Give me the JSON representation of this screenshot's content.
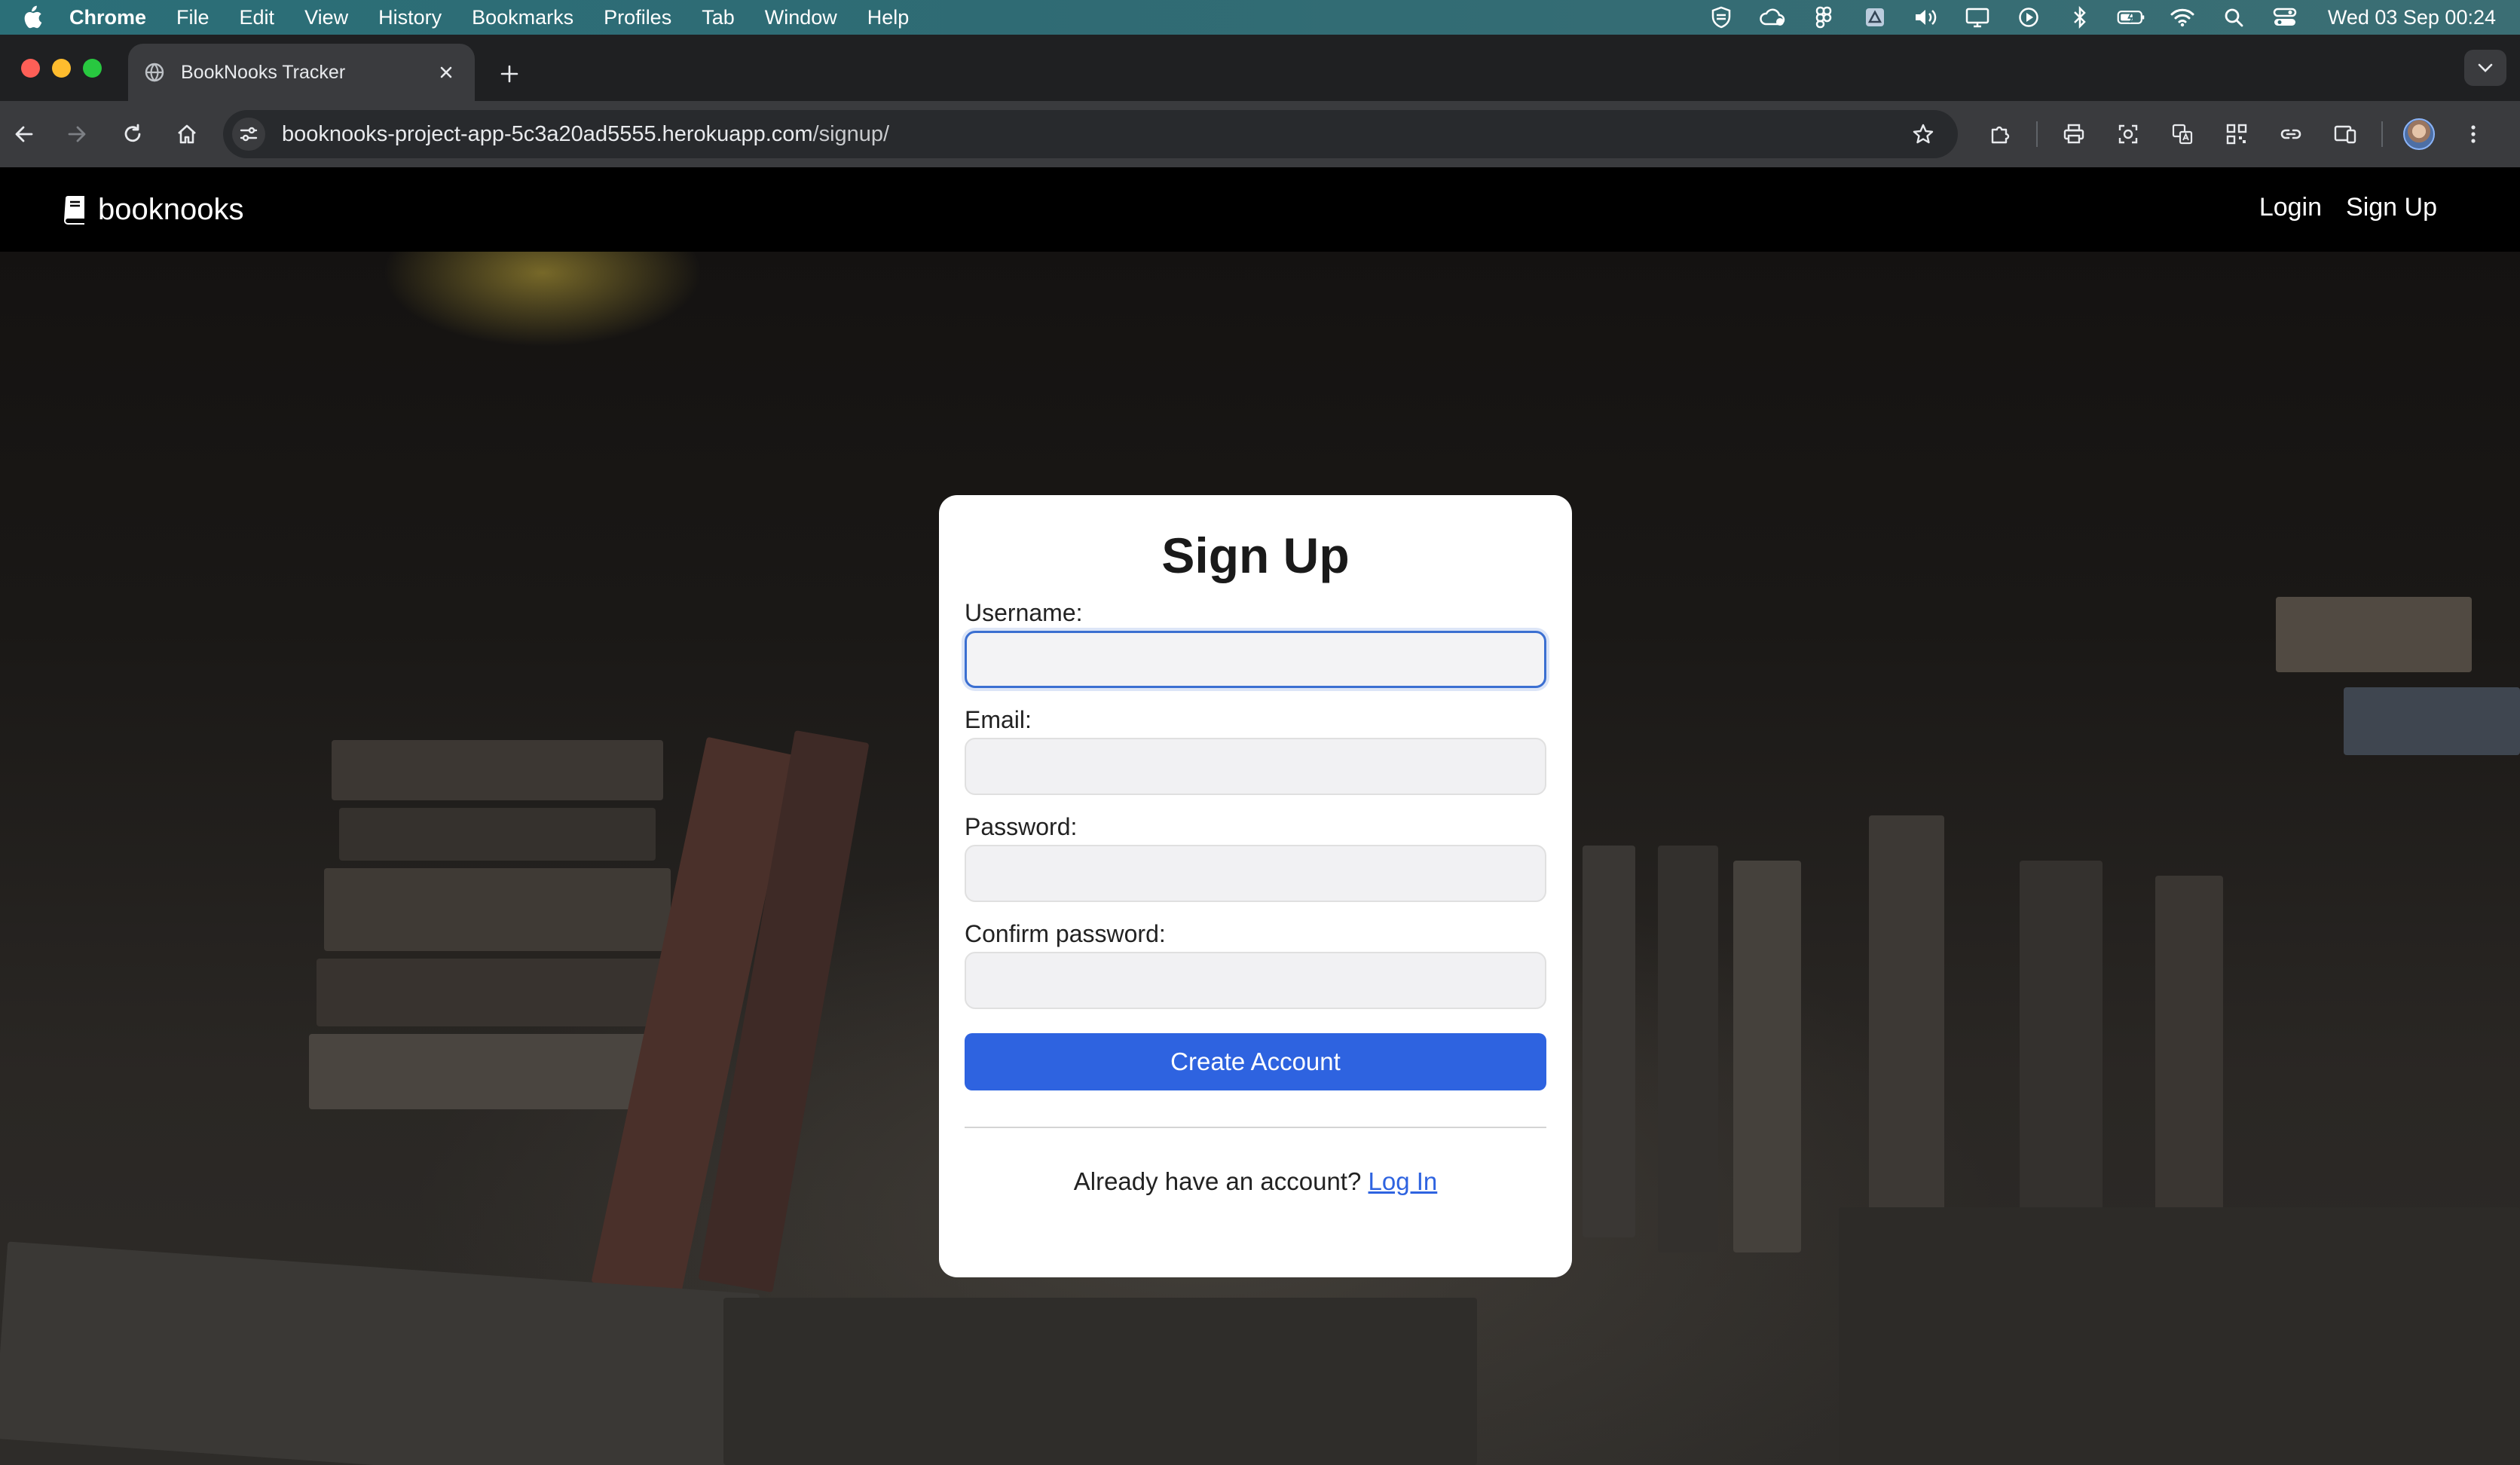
{
  "menubar": {
    "app_name": "Chrome",
    "items": [
      "File",
      "Edit",
      "View",
      "History",
      "Bookmarks",
      "Profiles",
      "Tab",
      "Window",
      "Help"
    ],
    "clock": "Wed 03 Sep  00:24"
  },
  "browser": {
    "tab_title": "BookNooks Tracker",
    "url_host": "booknooks-project-app-5c3a20ad5555.herokuapp.com",
    "url_path": "/signup/"
  },
  "app": {
    "brand": "booknooks",
    "nav": {
      "login": "Login",
      "signup": "Sign Up"
    }
  },
  "form": {
    "title": "Sign Up",
    "username_label": "Username:",
    "email_label": "Email:",
    "password_label": "Password:",
    "confirm_label": "Confirm password:",
    "username_value": "",
    "email_value": "",
    "password_value": "",
    "confirm_value": "",
    "submit_label": "Create Account",
    "footer_text": "Already have an account?",
    "footer_link": "Log In"
  },
  "colors": {
    "accent": "#2e63e0",
    "focus_ring": "#3b6fd1",
    "nav_bg": "#000000",
    "menubar_bg": "#2f6b74"
  }
}
